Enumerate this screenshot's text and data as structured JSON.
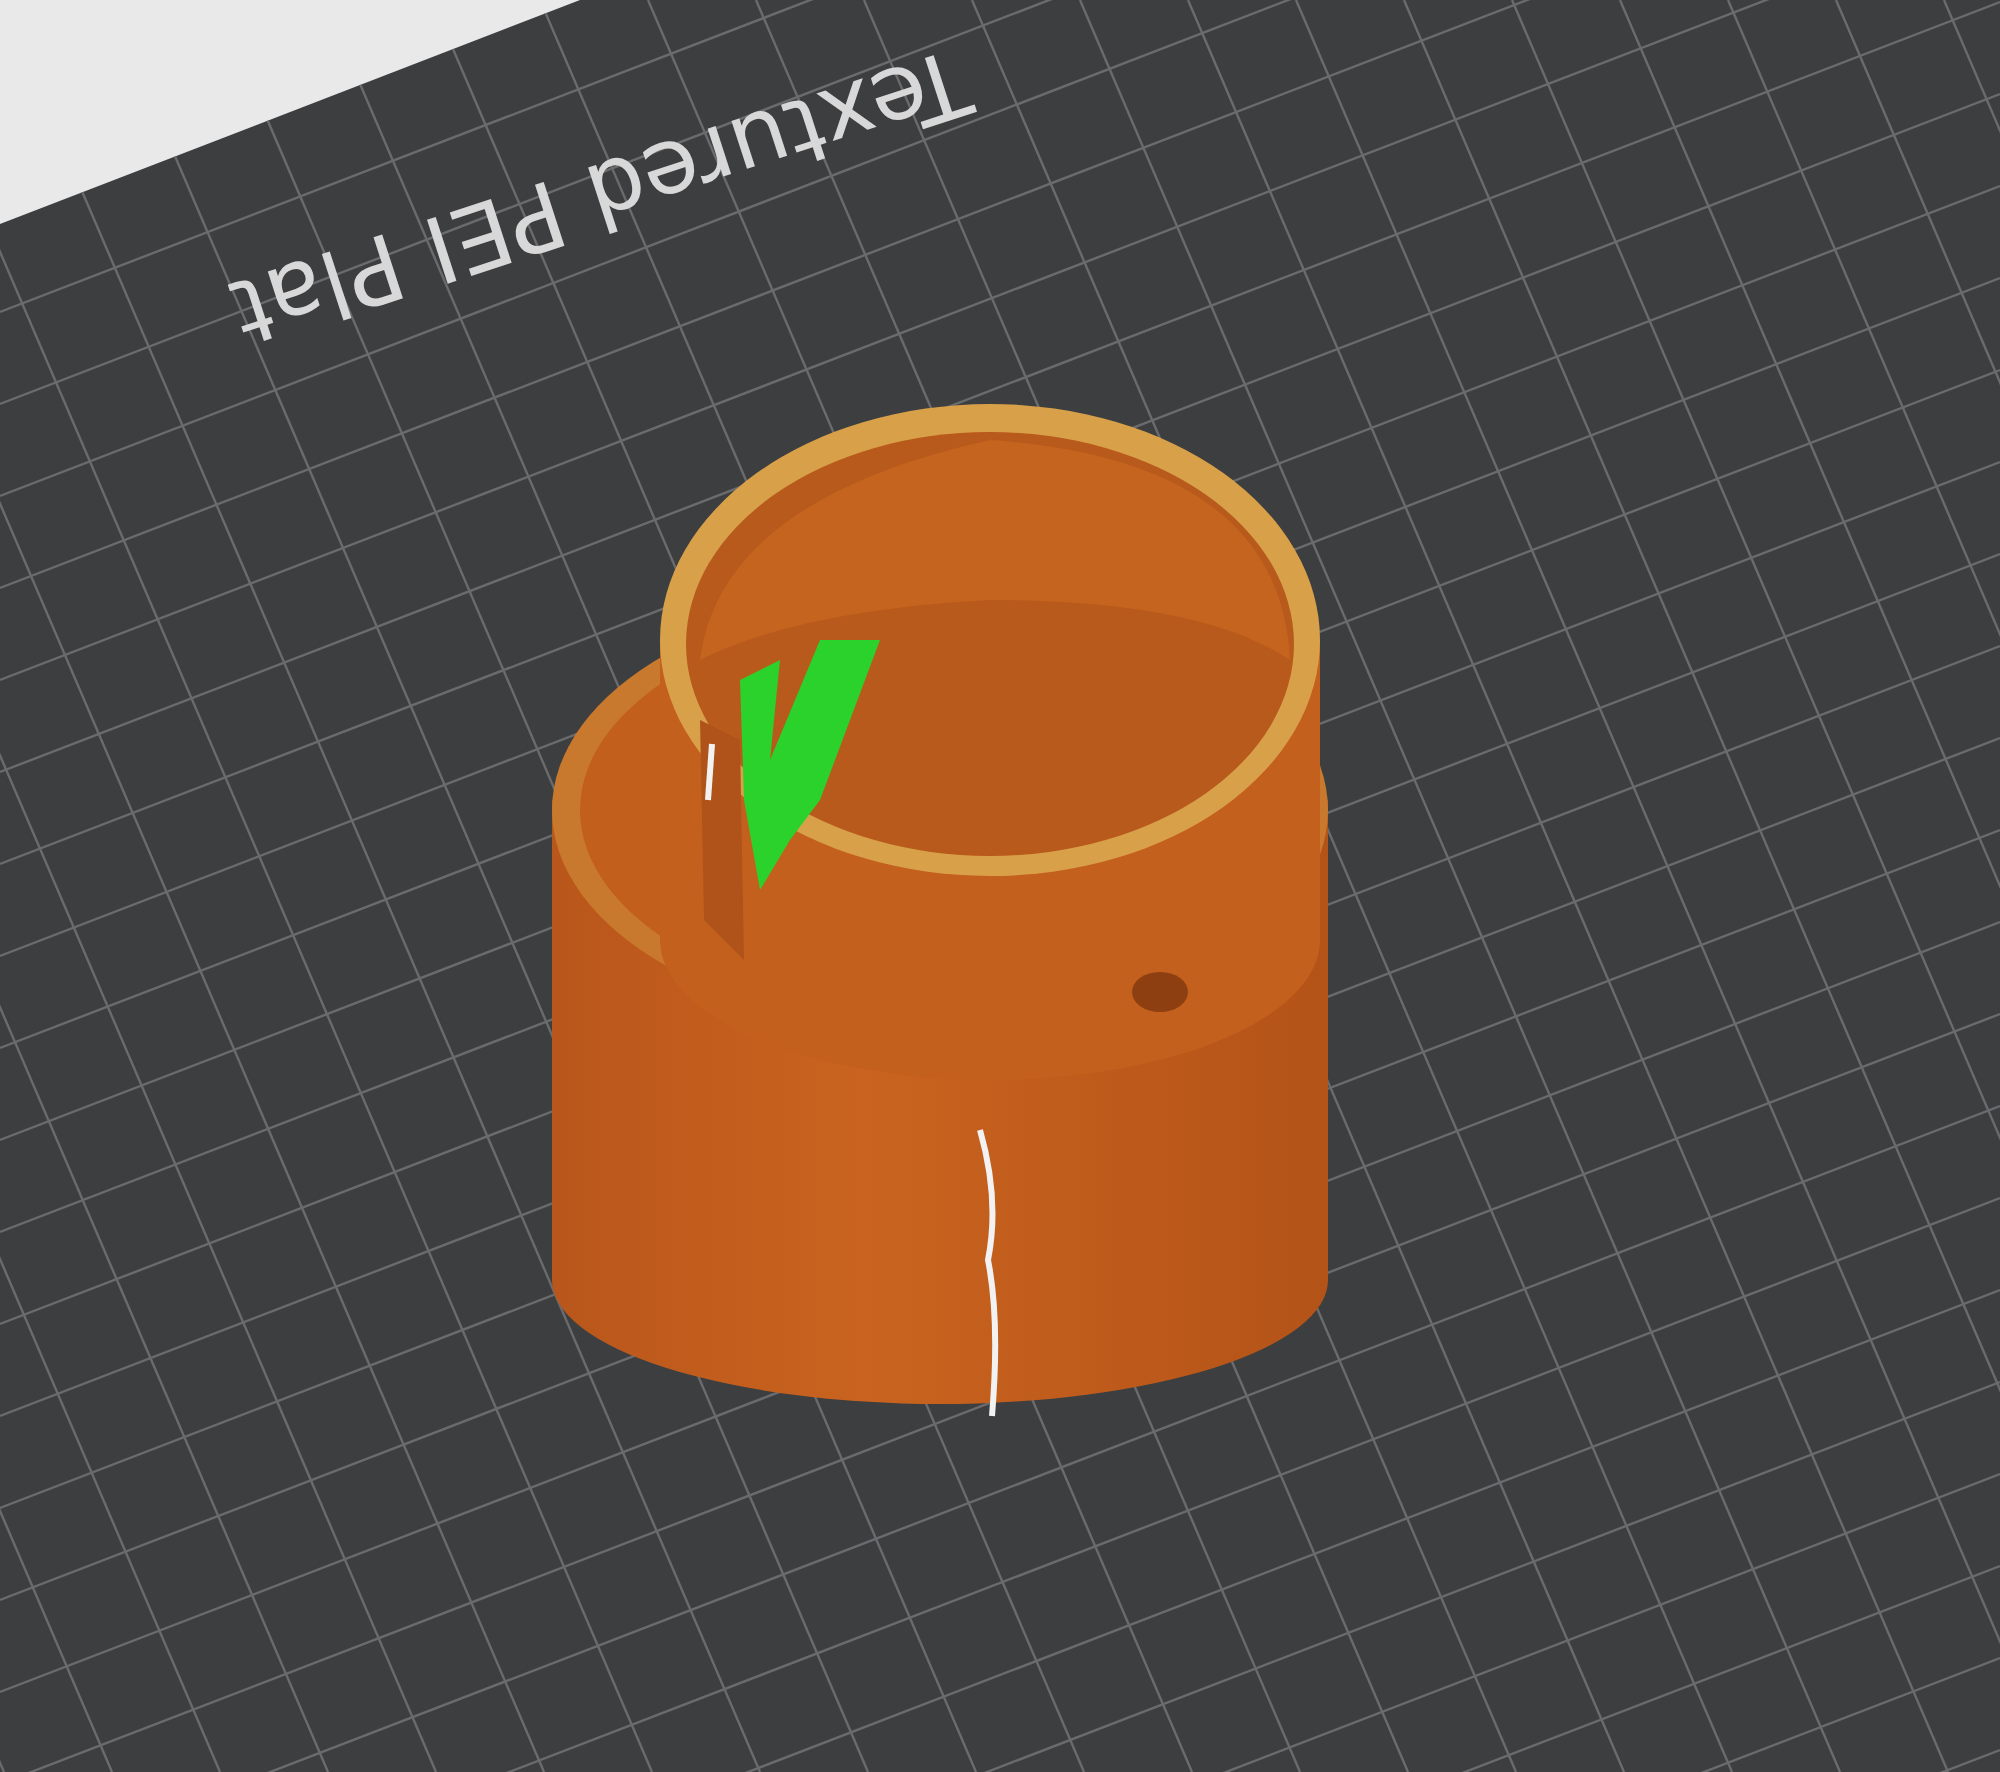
{
  "viewport": {
    "bed_label": "Textured PEI Plat"
  }
}
